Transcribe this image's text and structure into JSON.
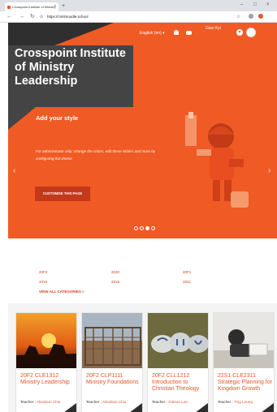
{
  "browser": {
    "tab_title": "Crosspoint Institute of Ministry",
    "tab_close": "×",
    "new_tab": "+",
    "url": "https://cimlmoodle.school",
    "win_min": "–",
    "win_max": "□",
    "win_close": "×"
  },
  "header": {
    "language": "English (en) ▾",
    "user_name": "Gian Kyi",
    "chevron": "▾"
  },
  "hero": {
    "title": "Crosspoint Institute of Ministry Leadership",
    "slide_heading": "Add your style",
    "slide_text": "For administrator only: change the colors, edit these sliders and more by configuring this theme",
    "button": "CUSTOMISE THIS PAGE",
    "prev": "‹",
    "next": "›",
    "slides": 4,
    "active_slide": 3
  },
  "categories": {
    "items": [
      "20F3",
      "2020",
      "20F1",
      "2019",
      "2018",
      "2021"
    ],
    "view_all": "VIEW ALL CATEGORIES  »"
  },
  "courses": [
    {
      "title": "20F2 CLE1312 Ministry Leadership",
      "teacher_label": "Teacher : ",
      "teacher": "Abraham Chiu"
    },
    {
      "title": "20F2 CLP1111 Ministry Foundations",
      "teacher_label": "Teacher : ",
      "teacher": "Abraham Chiu"
    },
    {
      "title": "20F2 CLL1212 Introduction to Christian Theology",
      "teacher_label": "Teacher : ",
      "teacher": "Gideon Lee"
    },
    {
      "title": "22S1 CLE2311 Strategic Planning for Kingdom Growth",
      "teacher_label": "Teacher : ",
      "teacher": "Ting Leung"
    }
  ],
  "colors": {
    "brand": "#f05a24",
    "dark": "#444444",
    "link": "#d4401c"
  }
}
